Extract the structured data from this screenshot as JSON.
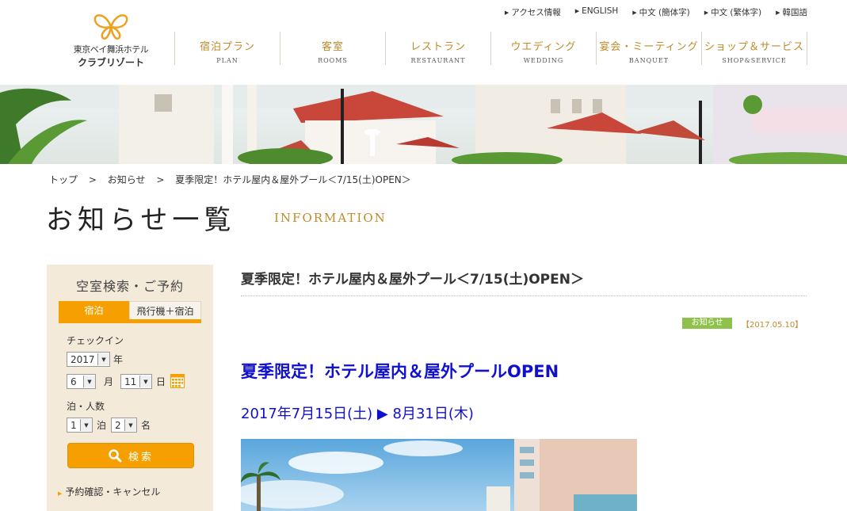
{
  "utility_links": [
    "アクセス情報",
    "ENGLISH",
    "中文 (簡体字)",
    "中文 (繁体字)",
    "韓国語"
  ],
  "logo": {
    "line1": "東京ベイ舞浜ホテル",
    "line2": "クラブリゾート"
  },
  "global_nav": [
    {
      "jp": "宿泊プラン",
      "en": "PLAN"
    },
    {
      "jp": "客室",
      "en": "ROOMS"
    },
    {
      "jp": "レストラン",
      "en": "RESTAURANT"
    },
    {
      "jp": "ウエディング",
      "en": "WEDDING"
    },
    {
      "jp": "宴会・ミーティング",
      "en": "BANQUET"
    },
    {
      "jp": "ショップ＆サービス",
      "en": "SHOP&SERVICE"
    }
  ],
  "breadcrumb": {
    "home": "トップ",
    "section": "お知らせ",
    "current": "夏季限定！ホテル屋内＆屋外プール＜7/15(土)OPEN＞",
    "sep": ">"
  },
  "page_title": {
    "jp": "お知らせ一覧",
    "en": "INFORMATION"
  },
  "sidebar": {
    "title": "空室検索・ご予約",
    "tabs": [
      "宿泊",
      "飛行機＋宿泊"
    ],
    "checkin_label": "チェックイン",
    "year": "2017",
    "year_unit": "年",
    "month": "6",
    "month_unit": "月",
    "day": "11",
    "day_unit": "日",
    "stay_label": "泊・人数",
    "nights": "1",
    "nights_unit": "泊",
    "people": "2",
    "people_unit": "名",
    "search_label": "検索",
    "reserve_link": "予約確認・キャンセル"
  },
  "article": {
    "title": "夏季限定！ホテル屋内＆屋外プール＜7/15(土)OPEN＞",
    "category": "お知らせ",
    "date": "【2017.05.10】",
    "heading": "夏季限定！ホテル屋内＆屋外プールOPEN",
    "period": "2017年7月15日(土) ▶ 8月31日(木)"
  },
  "colors": {
    "accent": "#f5a000",
    "gold": "#c08a2a",
    "badge": "#8ec24a",
    "link_blue": "#1111cc",
    "sidebar_bg": "#f3eada"
  }
}
